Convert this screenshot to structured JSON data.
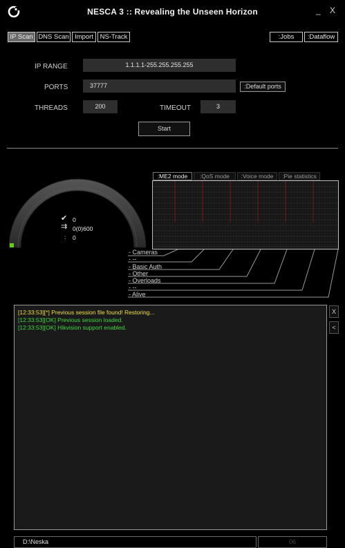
{
  "window": {
    "title": "NESCA 3 :: Revealing the Unseen Horizon",
    "minimize_label": "_",
    "close_label": "X"
  },
  "tabs": {
    "ip_scan": "IP Scan",
    "dns_scan": "DNS Scan",
    "import": "Import",
    "ns_track": "NS-Track",
    "jobs": ":Jobs",
    "dataflow": ":Dataflow"
  },
  "form": {
    "ip_range_label": "IP RANGE",
    "ip_range_value": "1.1.1.1-255.255.255.255",
    "ports_label": "PORTS",
    "ports_value": "37777",
    "default_ports_button": ":Default ports",
    "threads_label": "THREADS",
    "threads_value": "200",
    "timeout_label": "TIMEOUT",
    "timeout_value": "3",
    "start_button": "Start"
  },
  "gauge": {
    "found_count": "0",
    "threads_ratio": "0(0)600",
    "pending_count": "0",
    "check_symbol": "✔",
    "arrows_symbol": "⇉",
    "colon_symbol": ":",
    "level": 0
  },
  "modes": {
    "me2": ":ME2 mode",
    "qos": ":QoS mode",
    "voice": ":Voice mode",
    "pie": ":Pie statistics"
  },
  "legend": [
    "- Cameras",
    "- --",
    "- Basic Auth",
    "- Other",
    "- Overloads",
    "- --",
    "- Alive"
  ],
  "log": {
    "lines": [
      "[12:33:53][*] Previous session file found! Restoring...",
      "[12:33:53][OK] Previous session loaded.",
      "[12:33:53][OK] Hikvision support enabled."
    ],
    "colors": [
      "#f0e040",
      "#3ed83e",
      "#3ed83e"
    ]
  },
  "side_buttons": {
    "close": "X",
    "collapse": "<"
  },
  "status": {
    "path": "D:\\Neska",
    "progress": "06"
  },
  "colors": {
    "background": "#000000",
    "field": "#2e2e2e",
    "graph_marker": "#8a1c1c",
    "gauge_active": "#66cc22"
  }
}
